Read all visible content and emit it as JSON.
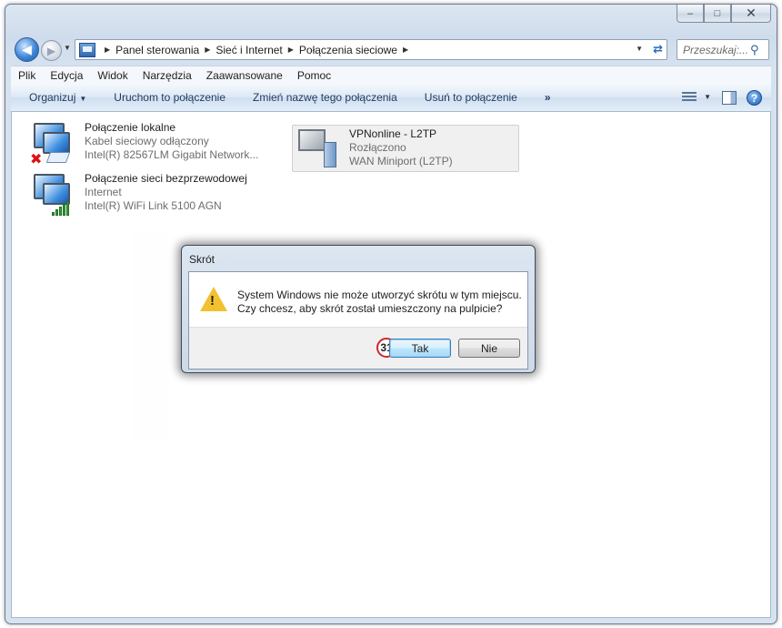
{
  "window": {
    "caption_buttons": {
      "minimize": "–",
      "maximize": "□",
      "close": "✕"
    }
  },
  "address": {
    "breadcrumbs": [
      "Panel sterowania",
      "Sieć i Internet",
      "Połączenia sieciowe"
    ],
    "search_placeholder": "Przeszukaj:..."
  },
  "menu": [
    "Plik",
    "Edycja",
    "Widok",
    "Narzędzia",
    "Zaawansowane",
    "Pomoc"
  ],
  "commands": {
    "organize": "Organizuj",
    "start": "Uruchom to połączenie",
    "rename": "Zmień nazwę tego połączenia",
    "delete": "Usuń to połączenie",
    "more": "»"
  },
  "connections": {
    "local": {
      "name": "Połączenie lokalne",
      "status": "Kabel sieciowy odłączony",
      "device": "Intel(R) 82567LM Gigabit Network..."
    },
    "wireless": {
      "name": "Połączenie sieci bezprzewodowej",
      "status": "Internet",
      "device": "Intel(R) WiFi Link 5100 AGN"
    },
    "vpn": {
      "name": "VPNonline - L2TP",
      "status": "Rozłączono",
      "device": "WAN Miniport (L2TP)"
    }
  },
  "dialog": {
    "title": "Skrót",
    "line1": "System Windows nie może utworzyć skrótu w tym miejscu.",
    "line2": "Czy chcesz, aby skrót został umieszczony na pulpicie?",
    "yes_label": "Tak",
    "no_label": "Nie",
    "step_badge": "31"
  },
  "icons": {
    "back": "back-arrow-icon",
    "forward": "forward-arrow-icon",
    "refresh": "refresh-icon",
    "search": "search-icon",
    "help": "help-icon",
    "warning": "warning-icon"
  }
}
